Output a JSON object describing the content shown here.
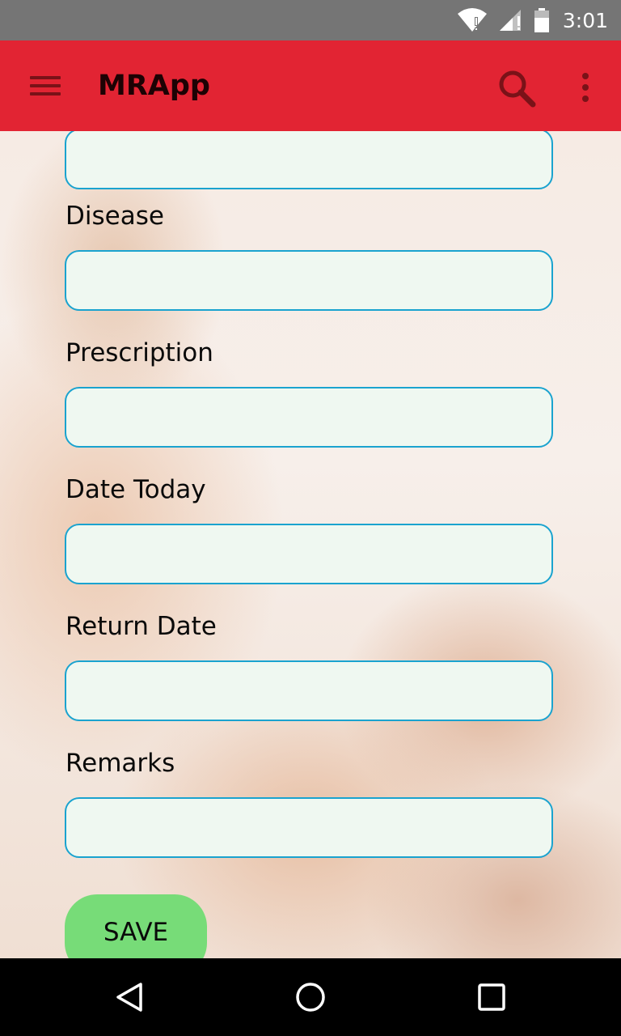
{
  "status_bar": {
    "time": "3:01",
    "icons": [
      "wifi-icon",
      "cell-signal-icon",
      "battery-icon"
    ]
  },
  "app_bar": {
    "title": "MRApp",
    "icons": [
      "menu-icon",
      "search-icon",
      "more-vert-icon"
    ],
    "background_color": "#e22433"
  },
  "form": {
    "fields": [
      {
        "label": "",
        "value": ""
      },
      {
        "label": "Disease",
        "value": ""
      },
      {
        "label": "Prescription",
        "value": ""
      },
      {
        "label": "Date Today",
        "value": ""
      },
      {
        "label": "Return Date",
        "value": ""
      },
      {
        "label": "Remarks",
        "value": ""
      }
    ],
    "save_label": "SAVE",
    "save_color": "#77dc78",
    "field_border_color": "#1aa3cf"
  },
  "nav_bar": {
    "icons": [
      "back-icon",
      "home-icon",
      "recents-icon"
    ]
  }
}
